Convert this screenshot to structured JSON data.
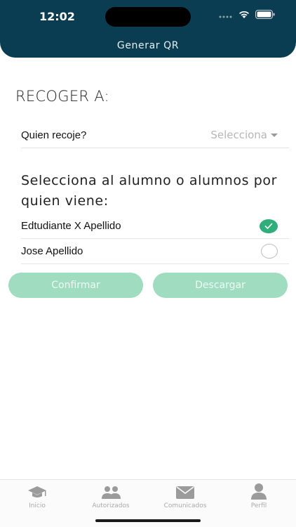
{
  "status_bar": {
    "time": "12:02"
  },
  "header": {
    "title": "Generar QR"
  },
  "main": {
    "section_title": "RECOGER A:",
    "pickup": {
      "label": "Quien recoje?",
      "select_value": "Selecciona"
    },
    "select_heading": "Selecciona al alumno o alumnos por quien viene:",
    "students": [
      {
        "name": "Edtudiante X Apellido",
        "selected": true
      },
      {
        "name": "Jose Apellido",
        "selected": false
      }
    ],
    "buttons": {
      "confirm": "Confirmar",
      "download": "Descargar"
    }
  },
  "tabbar": {
    "items": [
      {
        "label": "Inicio",
        "icon": "graduation-cap-icon"
      },
      {
        "label": "Autorizados",
        "icon": "people-icon"
      },
      {
        "label": "Comunicados",
        "icon": "envelope-icon"
      },
      {
        "label": "Perfil",
        "icon": "person-icon"
      }
    ]
  },
  "colors": {
    "header_bg": "#0b3d52",
    "accent_green": "#2fae7b",
    "button_disabled": "#9fdcc0"
  }
}
